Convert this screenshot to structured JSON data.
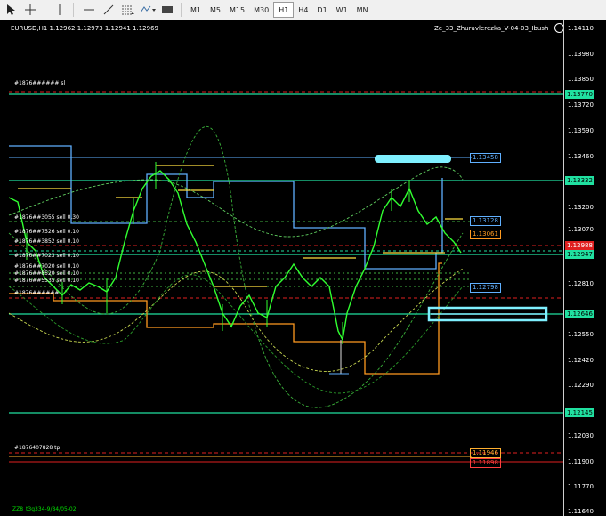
{
  "toolbar": {
    "icons": [
      "cursor-icon",
      "crosshair-icon",
      "vertical-line-icon",
      "horizontal-line-icon",
      "trendline-icon",
      "fibonacci-icon",
      "shapes-icon",
      "period-icon"
    ],
    "timeframes": [
      "M1",
      "M5",
      "M15",
      "M30",
      "H1",
      "H4",
      "D1",
      "W1",
      "MN"
    ],
    "active_timeframe": "H1"
  },
  "chart": {
    "symbol_header": "EURUSD,H1  1.12962 1.12973 1.12941 1.12969",
    "indicator_name": "Ze_33_Zhuravlerezka_V-04-03_Ibush",
    "bottom_label": "ZZ8_t3g334-9/84/05-02",
    "price_axis": [
      "1.14110",
      "1.13980",
      "1.13850",
      "1.13720",
      "1.13590",
      "1.13460",
      "1.13200",
      "1.13070",
      "1.12810",
      "1.12550",
      "1.12420",
      "1.12290",
      "1.12030",
      "1.11900",
      "1.11770",
      "1.11640"
    ],
    "axis_tags": [
      {
        "text": "1.13770",
        "color": "#20e0a0"
      },
      {
        "text": "1.13332",
        "color": "#20e0a0"
      },
      {
        "text": "1.12988",
        "color": "#e02020"
      },
      {
        "text": "1.12947",
        "color": "#20e0a0"
      },
      {
        "text": "1.12646",
        "color": "#20e0a0"
      },
      {
        "text": "1.12145",
        "color": "#20e0a0"
      }
    ],
    "line_labels": [
      {
        "text": "1.13458",
        "color": "#60b0ff"
      },
      {
        "text": "1.13128",
        "color": "#60b0ff"
      },
      {
        "text": "1.13061",
        "color": "#ff9a20"
      },
      {
        "text": "1.12798",
        "color": "#60b0ff"
      },
      {
        "text": "1.11946",
        "color": "#ffb030"
      },
      {
        "text": "1.11898",
        "color": "#ff4040"
      }
    ],
    "orders": [
      "#1876###### sl",
      "#1876##3055 sell 0.30",
      "#1876##7526 sell 0.10",
      "#1876##3852 sell 0.10",
      "#1876##7023 sell 0.10",
      "#1876##7020 sell 0.10",
      "#1876##8520 sell 0.10",
      "#1876##5535 sell 0.10",
      "#1876######",
      "#1876407828 tp"
    ]
  }
}
